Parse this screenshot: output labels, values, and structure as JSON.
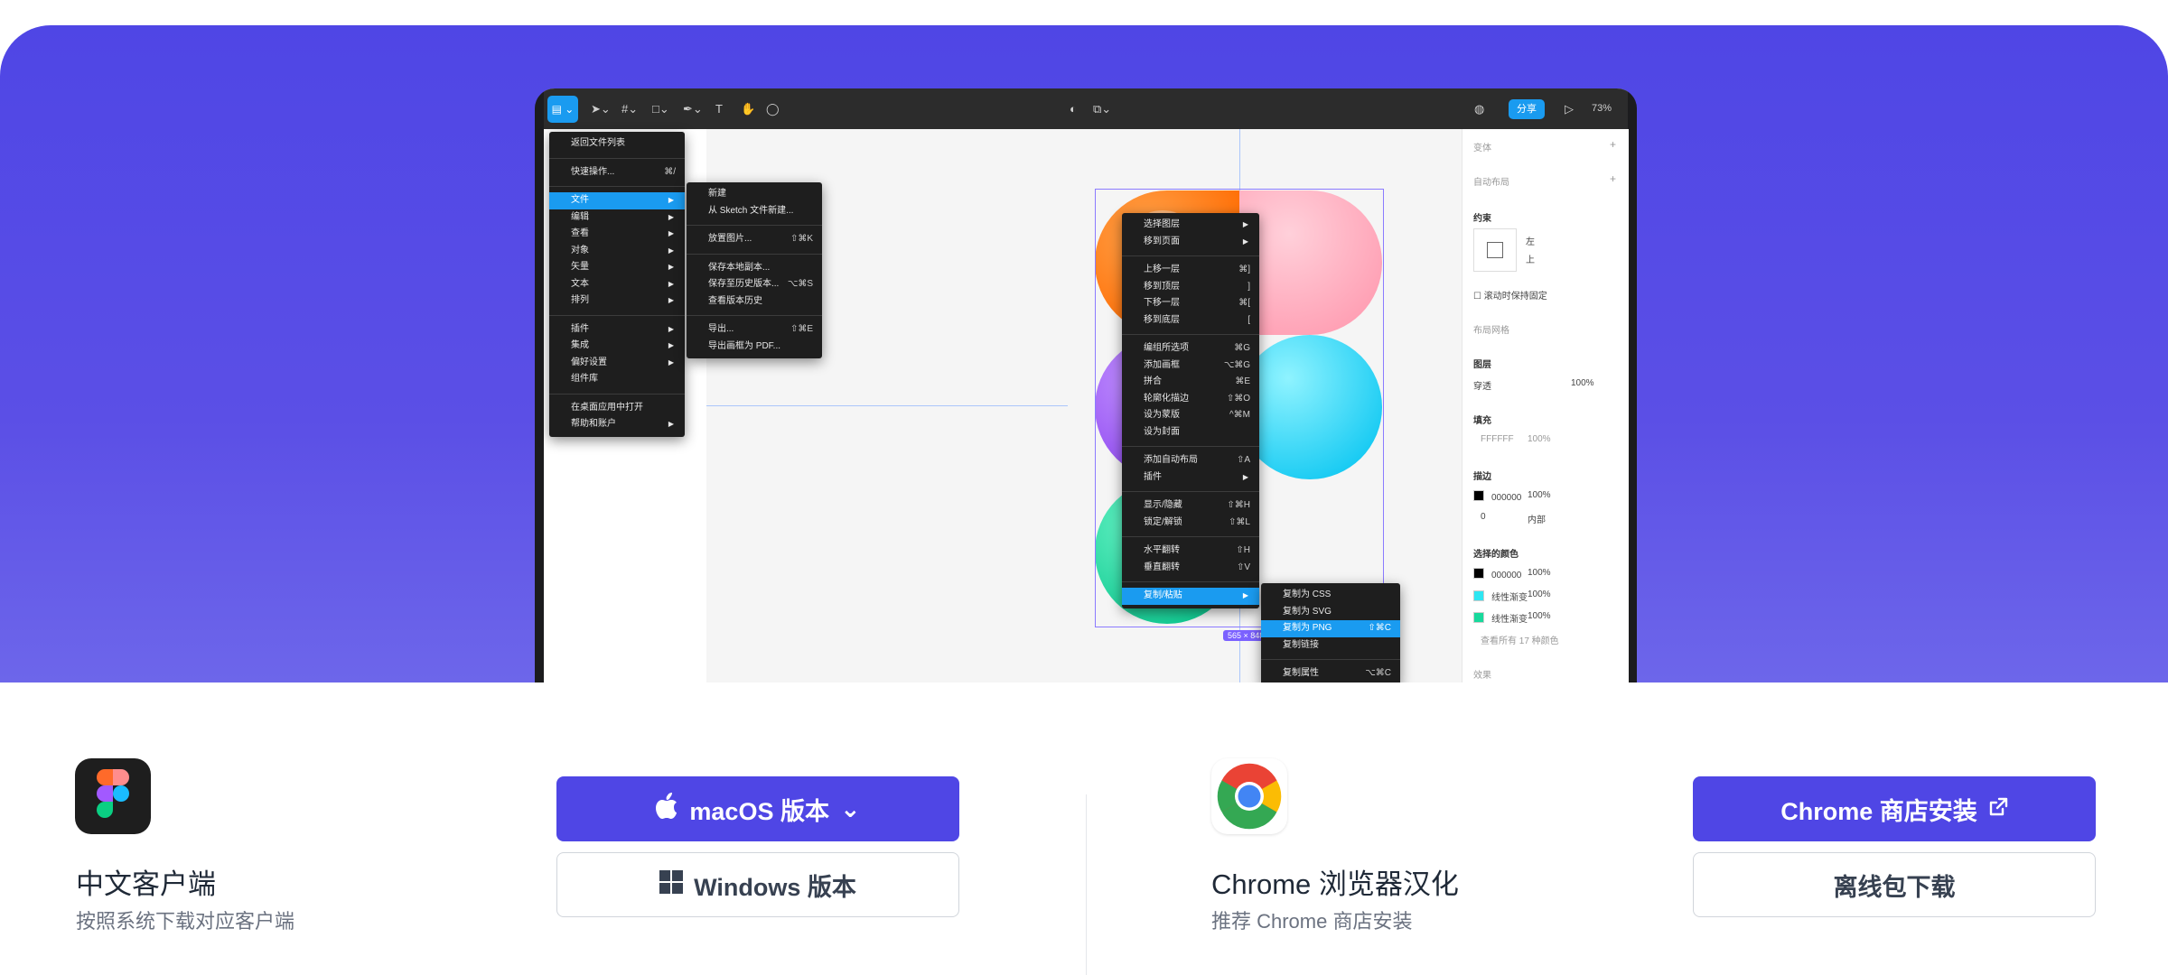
{
  "editor": {
    "share_label": "分享",
    "zoom": "73%",
    "size_tag": "565 × 848",
    "main_menu": [
      {
        "label": "返回文件列表",
        "shortcut": ""
      },
      {
        "label": "快速操作...",
        "shortcut": "⌘/"
      },
      {
        "label": "文件",
        "shortcut": "",
        "highlight": true,
        "submenu": true
      },
      {
        "label": "编辑",
        "submenu": true
      },
      {
        "label": "查看",
        "submenu": true
      },
      {
        "label": "对象",
        "submenu": true
      },
      {
        "label": "矢量",
        "submenu": true
      },
      {
        "label": "文本",
        "submenu": true
      },
      {
        "label": "排列",
        "submenu": true
      },
      {
        "label": "插件",
        "submenu": true
      },
      {
        "label": "集成",
        "submenu": true
      },
      {
        "label": "偏好设置",
        "submenu": true
      },
      {
        "label": "组件库"
      },
      {
        "label": "在桌面应用中打开"
      },
      {
        "label": "帮助和账户",
        "submenu": true
      }
    ],
    "file_menu": [
      {
        "label": "新建",
        "shortcut": ""
      },
      {
        "label": "从 Sketch 文件新建...",
        "shortcut": ""
      },
      {
        "label": "放置图片...",
        "shortcut": "⇧⌘K"
      },
      {
        "label": "保存本地副本...",
        "shortcut": ""
      },
      {
        "label": "保存至历史版本...",
        "shortcut": "⌥⌘S"
      },
      {
        "label": "查看版本历史",
        "shortcut": ""
      },
      {
        "label": "导出...",
        "shortcut": "⇧⌘E"
      },
      {
        "label": "导出画框为 PDF...",
        "shortcut": ""
      }
    ],
    "context_menu": [
      {
        "label": "选择图层",
        "submenu": true
      },
      {
        "label": "移到页面",
        "submenu": true
      },
      {
        "label": "上移一层",
        "shortcut": "⌘]"
      },
      {
        "label": "移到顶层",
        "shortcut": "]"
      },
      {
        "label": "下移一层",
        "shortcut": "⌘["
      },
      {
        "label": "移到底层",
        "shortcut": "["
      },
      {
        "label": "编组所选项",
        "shortcut": "⌘G"
      },
      {
        "label": "添加画框",
        "shortcut": "⌥⌘G"
      },
      {
        "label": "拼合",
        "shortcut": "⌘E"
      },
      {
        "label": "轮廓化描边",
        "shortcut": "⇧⌘O"
      },
      {
        "label": "设为蒙版",
        "shortcut": "^⌘M"
      },
      {
        "label": "设为封面",
        "shortcut": ""
      },
      {
        "label": "添加自动布局",
        "shortcut": "⇧A"
      },
      {
        "label": "插件",
        "submenu": true
      },
      {
        "label": "显示/隐藏",
        "shortcut": "⇧⌘H"
      },
      {
        "label": "锁定/解锁",
        "shortcut": "⇧⌘L"
      },
      {
        "label": "水平翻转",
        "shortcut": "⇧H"
      },
      {
        "label": "垂直翻转",
        "shortcut": "⇧V"
      },
      {
        "label": "复制/粘贴",
        "submenu": true,
        "highlight": true
      }
    ],
    "copy_menu": [
      {
        "label": "复制为 CSS",
        "shortcut": ""
      },
      {
        "label": "复制为 SVG",
        "shortcut": ""
      },
      {
        "label": "复制为 PNG",
        "shortcut": "⇧⌘C",
        "highlight": true
      },
      {
        "label": "复制链接",
        "shortcut": ""
      },
      {
        "label": "复制属性",
        "shortcut": "⌥⌘C"
      }
    ],
    "right_panel": {
      "variants": "变体",
      "auto_layout": "自动布局",
      "constraints": "约束",
      "constraint_h": "左",
      "constraint_v": "上",
      "fixed_scroll": "滚动时保持固定",
      "layout_grid": "布局网格",
      "layer": "图层",
      "blend": "穿透",
      "layer_opacity": "100%",
      "fill": "填充",
      "fill_hex": "FFFFFF",
      "fill_opacity": "100%",
      "stroke": "描边",
      "stroke_hex": "000000",
      "stroke_opacity": "100%",
      "stroke_width": "0",
      "stroke_pos": "内部",
      "selection_colors": "选择的颜色",
      "sel_colors": [
        {
          "name": "000000",
          "opacity": "100%",
          "color": "#000000"
        },
        {
          "name": "线性渐变",
          "opacity": "100%",
          "color": "#2ee6f2"
        },
        {
          "name": "线性渐变",
          "opacity": "100%",
          "color": "#18d99c"
        }
      ],
      "more_colors": "查看所有 17 种颜色",
      "effects": "效果"
    }
  },
  "downloads": {
    "client": {
      "title": "中文客户端",
      "subtitle": "按照系统下载对应客户端",
      "mac_label": "macOS 版本",
      "win_label": "Windows 版本"
    },
    "chrome": {
      "title": "Chrome 浏览器汉化",
      "subtitle": "推荐 Chrome 商店安装",
      "store_label": "Chrome 商店安装",
      "offline_label": "离线包下载"
    }
  },
  "colors": {
    "brand": "#4f46e5",
    "figma_blue": "#1a9bf0",
    "orange": "#ff7a0f",
    "pink": "#ffb3c1",
    "purple": "#a05cf6",
    "cyan": "#18d6f7",
    "green": "#12d99c"
  }
}
